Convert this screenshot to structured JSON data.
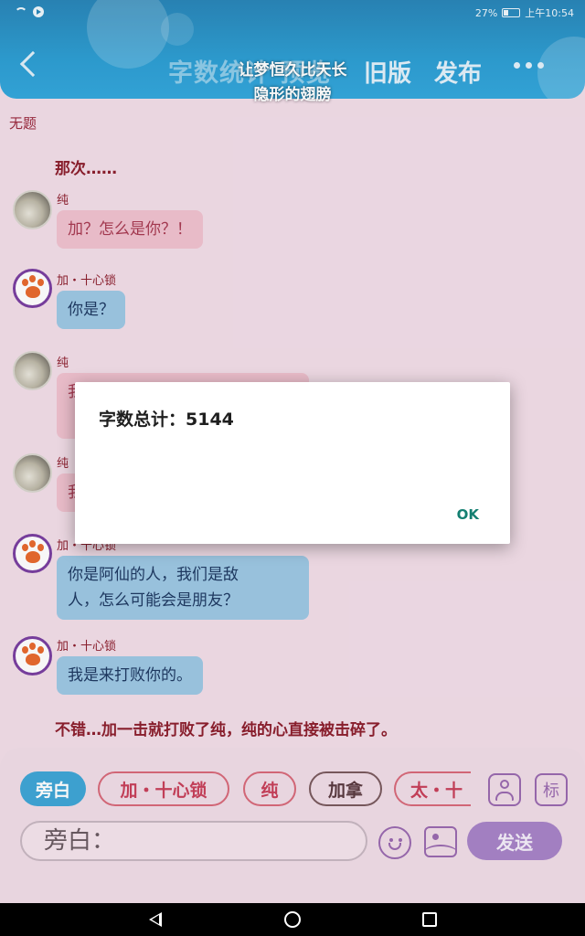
{
  "status_bar": {
    "battery": "27%",
    "time": "上午10:54",
    "battery_level": 0.27
  },
  "header": {
    "title_faded": "字数统计  预览",
    "tab_old": "旧版",
    "tab_publish": "发布"
  },
  "toast": {
    "line1": "让梦恒久比天长",
    "line2": "隐形的翅膀"
  },
  "story": {
    "title": "无题",
    "narration_1": "那次……",
    "messages": [
      {
        "speaker": "纯",
        "text": "加？怎么是你？！"
      },
      {
        "speaker": "加・十心锁",
        "text": "你是？"
      },
      {
        "speaker": "纯",
        "text": "我"
      },
      {
        "speaker": "纯",
        "text": "我"
      },
      {
        "speaker": "加・十心锁",
        "line1": "你是阿仙的人，我们是敌",
        "line2": "人，怎么可能会是朋友？"
      },
      {
        "speaker": "加・十心锁",
        "text": "我是来打败你的。"
      }
    ],
    "narration_2": "不错…加一击就打败了纯，纯的心直接被击碎了。"
  },
  "dialog": {
    "title": "字数总计：5144",
    "ok": "OK"
  },
  "composer": {
    "chips": [
      "旁白",
      "加・十心锁",
      "纯",
      "加拿",
      "太・十"
    ],
    "input_value": "旁白：",
    "send": "发送",
    "label_icon": "标"
  }
}
